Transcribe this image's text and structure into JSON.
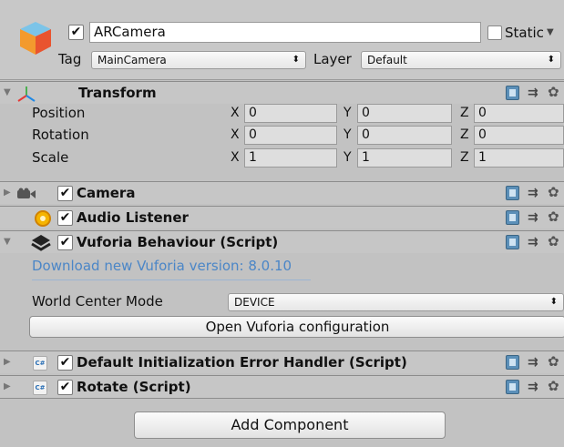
{
  "header": {
    "object_name": "ARCamera",
    "active_checked": true,
    "static_label": "Static",
    "tag_label": "Tag",
    "tag_value": "MainCamera",
    "layer_label": "Layer",
    "layer_value": "Default"
  },
  "transform": {
    "title": "Transform",
    "rows": [
      {
        "label": "Position",
        "x": "0",
        "y": "0",
        "z": "0"
      },
      {
        "label": "Rotation",
        "x": "0",
        "y": "0",
        "z": "0"
      },
      {
        "label": "Scale",
        "x": "1",
        "y": "1",
        "z": "1"
      }
    ],
    "axis_x": "X",
    "axis_y": "Y",
    "axis_z": "Z"
  },
  "components": {
    "camera": {
      "title": "Camera",
      "enabled": true
    },
    "audio_listener": {
      "title": "Audio Listener",
      "enabled": true
    },
    "vuforia": {
      "title": "Vuforia Behaviour (Script)",
      "enabled": true,
      "download_link": "Download new Vuforia version: 8.0.10",
      "world_center_label": "World Center Mode",
      "world_center_value": "DEVICE",
      "open_config_label": "Open Vuforia configuration"
    },
    "error_handler": {
      "title": "Default Initialization Error Handler (Script)",
      "enabled": true,
      "icon_text": "C#"
    },
    "rotate": {
      "title": "Rotate (Script)",
      "enabled": true,
      "icon_text": "C#"
    }
  },
  "add_component_label": "Add Component",
  "colors": {
    "link": "#4b86c7",
    "panel": "#c2c2c2",
    "book_icon": "#5b8fb8"
  }
}
